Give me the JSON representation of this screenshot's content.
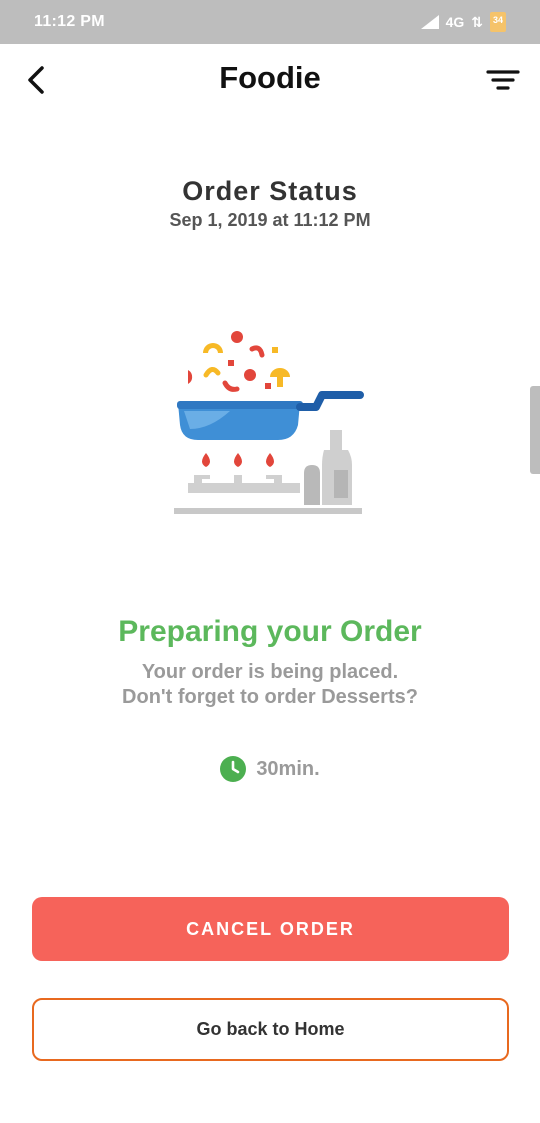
{
  "status_bar": {
    "time": "11:12 PM",
    "network": "4G",
    "battery_level": "34",
    "icons": [
      "signal-icon",
      "data-arrows-icon",
      "battery-icon"
    ]
  },
  "app_bar": {
    "title": "Foodie",
    "icons": [
      "back-arrow-icon",
      "filter-icon"
    ]
  },
  "order": {
    "title": "Order Status",
    "date": "Sep 1, 2019 at 11:12 PM",
    "illustration": "cooking-pan-on-stove-illustration"
  },
  "status": {
    "heading": "Preparing your Order",
    "line1": "Your order is being placed.",
    "line2": "Don't forget to order Desserts?",
    "eta": "30min.",
    "eta_icon": "clock-icon"
  },
  "actions": {
    "cancel_label": "CANCEL ORDER",
    "home_label": "Go back to Home"
  },
  "colors": {
    "status_bar": "#bdbdbd",
    "accent_green": "#5cb85c",
    "cancel_red": "#f6635a",
    "home_border_orange": "#e8691f",
    "pan_blue": "#3f8fd6",
    "handle_blue": "#1f5ea8"
  }
}
